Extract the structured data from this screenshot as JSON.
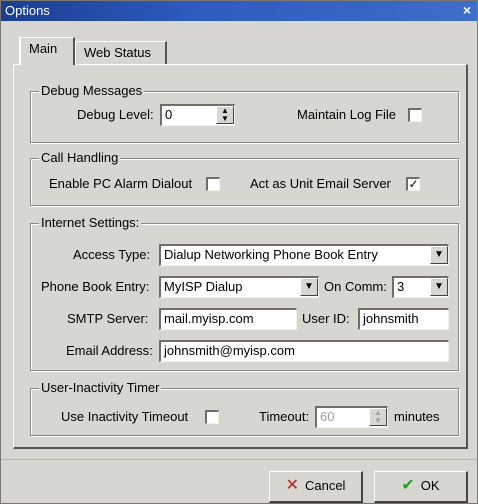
{
  "window": {
    "title": "Options",
    "close_glyph": "×"
  },
  "tabs": [
    {
      "label": "Main"
    },
    {
      "label": "Web Status"
    }
  ],
  "debug": {
    "group_title": "Debug Messages",
    "level_label": "Debug Level:",
    "level_value": "0",
    "log_label": "Maintain Log File",
    "log_checked": false
  },
  "call": {
    "group_title": "Call Handling",
    "dialout_label": "Enable PC Alarm Dialout",
    "dialout_checked": false,
    "email_server_label": "Act as Unit Email Server",
    "email_server_checked": true,
    "check_glyph": "✓"
  },
  "internet": {
    "group_title": "Internet Settings:",
    "access_type_label": "Access Type:",
    "access_type_value": "Dialup Networking Phone Book Entry",
    "phonebook_label": "Phone Book Entry:",
    "phonebook_value": "MyISP Dialup",
    "comm_label": "On Comm:",
    "comm_value": "3",
    "smtp_label": "SMTP Server:",
    "smtp_value": "mail.myisp.com",
    "userid_label": "User ID:",
    "userid_value": "johnsmith",
    "email_label": "Email Address:",
    "email_value": "johnsmith@myisp.com"
  },
  "inactivity": {
    "group_title": "User-Inactivity Timer",
    "use_label": "Use Inactivity Timeout",
    "use_checked": false,
    "timeout_label": "Timeout:",
    "timeout_value": "60",
    "minutes_label": "minutes"
  },
  "buttons": {
    "cancel_label": "Cancel",
    "ok_label": "OK"
  },
  "icons": {
    "dropdown": "chevron-down-icon",
    "spinner": "spinner-arrows-icon",
    "cancel": "x-icon",
    "ok": "checkmark-icon"
  }
}
